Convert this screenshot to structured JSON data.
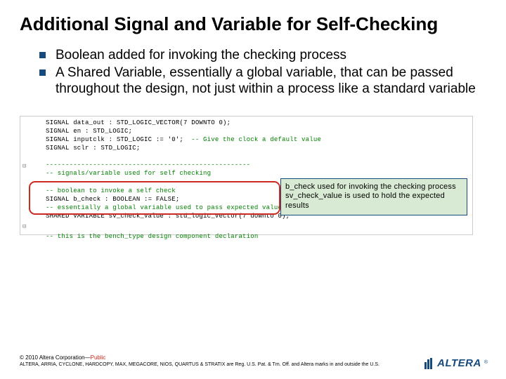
{
  "title": "Additional Signal and Variable for Self-Checking",
  "bullets": [
    "Boolean added for invoking the checking process",
    "A Shared Variable, essentially a global variable, that can be passed throughout the design, not just within a process like a standard variable"
  ],
  "code": {
    "l1": "SIGNAL data_out : STD_LOGIC_VECTOR(7 DOWNTO 0);",
    "l2": "SIGNAL en : STD_LOGIC;",
    "l3": "SIGNAL inputclk : STD_LOGIC := '0';",
    "l3c": "  -- Give the clock a default value",
    "l4": "SIGNAL sclr : STD_LOGIC;",
    "sep": "----------------------------------------------------",
    "sec_c": "-- signals/variable used for self checking",
    "c1": "-- boolean to invoke a self check",
    "c2a": "SIGNAL b_check : BOOLEAN := FALSE;",
    "c2b": "-- essentially a global variable used to pass expected values aro",
    "c3": "SHARED VARIABLE sv_check_value : std_logic_vector(7 downto 0);",
    "tail": "-- this is the bench_type design component declaration"
  },
  "callout": {
    "l1": "b_check used for invoking the checking process",
    "l2": "sv_check_value is used to hold the expected results"
  },
  "footer": {
    "copyright_prefix": "© 2010 Altera Corporation—",
    "copyright_suffix": "Public",
    "legal": "ALTERA, ARRIA, CYCLONE, HARDCOPY, MAX, MEGACORE, NIOS, QUARTUS & STRATIX are Reg. U.S. Pat. & Tm. Off. and Altera marks in and outside the U.S."
  },
  "logo": {
    "text": "ALTERA",
    "reg": "®"
  }
}
